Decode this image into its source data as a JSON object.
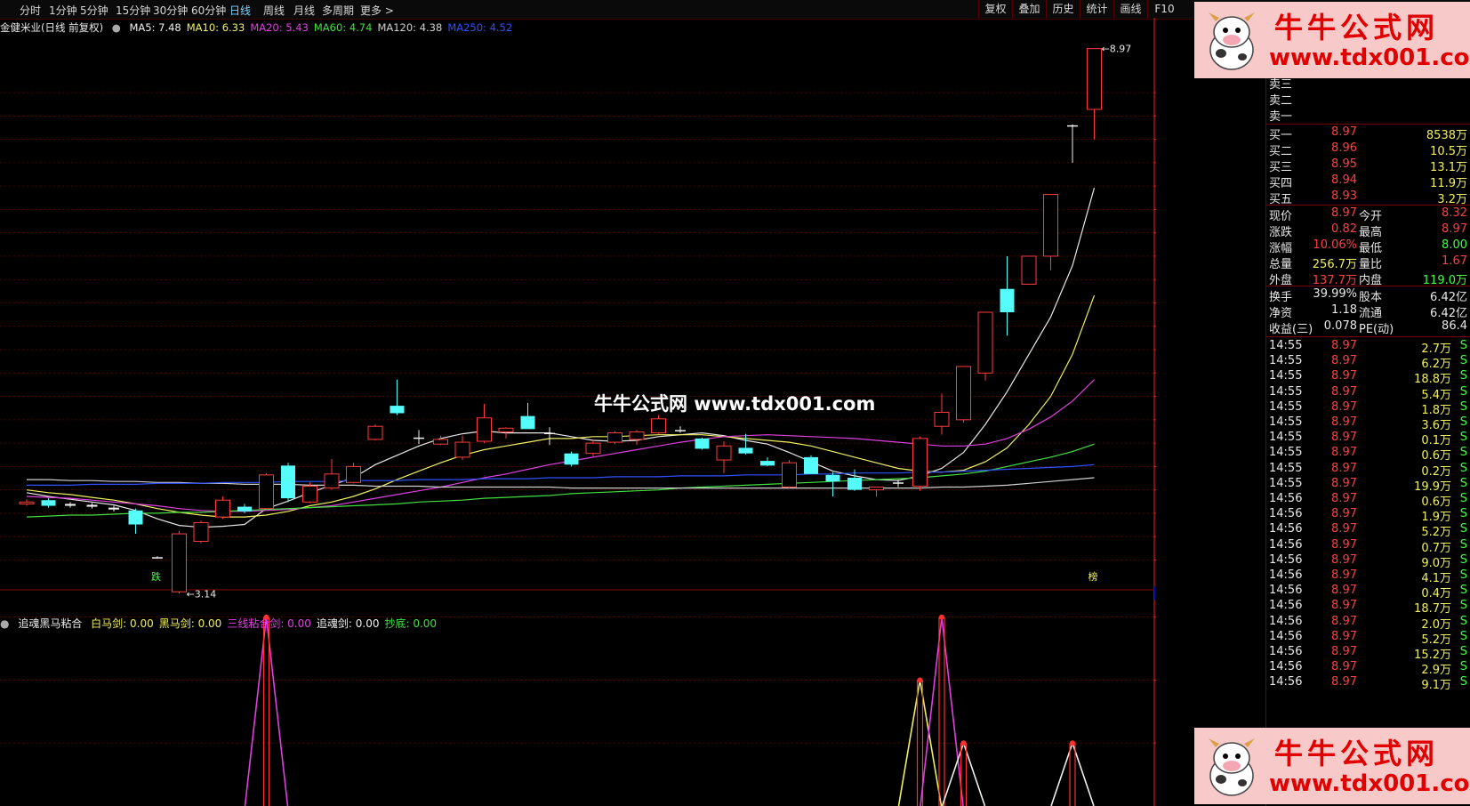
{
  "toolbar": {
    "periods": [
      "分时",
      "1分钟",
      "5分钟",
      "15分钟",
      "30分钟",
      "60分钟",
      "日线",
      "周线",
      "月线",
      "多周期",
      "更多 >"
    ],
    "active_period": "日线",
    "tools": [
      "复权",
      "叠加",
      "历史",
      "统计",
      "画线",
      "F10"
    ]
  },
  "stock_title": "金健米业(日线 前复权)",
  "ma_legend": [
    {
      "label": "MA5: 7.48",
      "color": "#f0f0f0"
    },
    {
      "label": "MA10: 6.33",
      "color": "#f0f060"
    },
    {
      "label": "MA20: 5.43",
      "color": "#e040e0"
    },
    {
      "label": "MA60: 4.74",
      "color": "#40e040"
    },
    {
      "label": "MA120: 4.38",
      "color": "#d0d0d0"
    },
    {
      "label": "MA250: 4.52",
      "color": "#3050ff"
    }
  ],
  "indicator_legend": {
    "name": "追魂黑马粘合",
    "items": [
      {
        "label": "白马剑: 0.00",
        "color": "#f0f060"
      },
      {
        "label": "黑马剑: 0.00",
        "color": "#f0f060"
      },
      {
        "label": "三线粘合剑: 0.00",
        "color": "#e040e0"
      },
      {
        "label": "追魂剑: 0.00",
        "color": "#f0f0f0"
      },
      {
        "label": "抄底: 0.00",
        "color": "#40e040"
      }
    ]
  },
  "markers": {
    "low_label": "3.14",
    "high_label": "8.97",
    "die_label": "跌",
    "axis_low": "3.14",
    "right_tag": "榜"
  },
  "chart_data": [
    {
      "type": "candlestick",
      "title": "金健米业(日线 前复权)",
      "ylim": [
        3.2,
        9.1
      ],
      "yticks": [
        "8.50",
        "8.25",
        "8.00",
        "7.75",
        "7.50",
        "7.25",
        "7.00",
        "6.75",
        "6.50",
        "6.25",
        "6.00",
        "5.75",
        "5.50",
        "5.25",
        "5.00",
        "4.75",
        "4.50",
        "4.25",
        "4.00",
        "3.75",
        "3.50"
      ],
      "candles": [
        {
          "o": 4.1,
          "h": 4.15,
          "l": 4.08,
          "c": 4.12
        },
        {
          "o": 4.14,
          "h": 4.16,
          "l": 4.06,
          "c": 4.08
        },
        {
          "o": 4.08,
          "h": 4.12,
          "l": 4.06,
          "c": 4.1
        },
        {
          "o": 4.09,
          "h": 4.11,
          "l": 4.05,
          "c": 4.07
        },
        {
          "o": 4.06,
          "h": 4.08,
          "l": 4.02,
          "c": 4.04
        },
        {
          "o": 4.03,
          "h": 4.05,
          "l": 3.78,
          "c": 3.88
        },
        {
          "o": 3.53,
          "h": 3.54,
          "l": 3.52,
          "c": 3.53
        },
        {
          "o": 3.16,
          "h": 3.81,
          "l": 3.14,
          "c": 3.78
        },
        {
          "o": 3.7,
          "h": 3.92,
          "l": 3.68,
          "c": 3.9
        },
        {
          "o": 3.96,
          "h": 4.18,
          "l": 3.94,
          "c": 4.14
        },
        {
          "o": 4.07,
          "h": 4.1,
          "l": 4.0,
          "c": 4.02
        },
        {
          "o": 4.05,
          "h": 4.43,
          "l": 4.04,
          "c": 4.41
        },
        {
          "o": 4.51,
          "h": 4.54,
          "l": 4.12,
          "c": 4.16
        },
        {
          "o": 4.12,
          "h": 4.33,
          "l": 4.11,
          "c": 4.29
        },
        {
          "o": 4.27,
          "h": 4.58,
          "l": 4.25,
          "c": 4.42
        },
        {
          "o": 4.33,
          "h": 4.54,
          "l": 4.32,
          "c": 4.5
        },
        {
          "o": 4.79,
          "h": 4.95,
          "l": 4.78,
          "c": 4.93
        },
        {
          "o": 5.15,
          "h": 5.43,
          "l": 5.05,
          "c": 5.07
        },
        {
          "o": 4.81,
          "h": 4.89,
          "l": 4.74,
          "c": 4.8
        },
        {
          "o": 4.74,
          "h": 4.83,
          "l": 4.73,
          "c": 4.79
        },
        {
          "o": 4.6,
          "h": 4.83,
          "l": 4.57,
          "c": 4.76
        },
        {
          "o": 4.77,
          "h": 5.17,
          "l": 4.75,
          "c": 5.02
        },
        {
          "o": 4.87,
          "h": 4.92,
          "l": 4.8,
          "c": 4.91
        },
        {
          "o": 5.04,
          "h": 5.18,
          "l": 4.92,
          "c": 4.9
        },
        {
          "o": 4.85,
          "h": 4.92,
          "l": 4.73,
          "c": 4.86
        },
        {
          "o": 4.64,
          "h": 4.66,
          "l": 4.5,
          "c": 4.52
        },
        {
          "o": 4.64,
          "h": 4.78,
          "l": 4.61,
          "c": 4.75
        },
        {
          "o": 4.76,
          "h": 4.88,
          "l": 4.74,
          "c": 4.86
        },
        {
          "o": 4.79,
          "h": 4.89,
          "l": 4.73,
          "c": 4.87
        },
        {
          "o": 4.86,
          "h": 5.05,
          "l": 4.85,
          "c": 5.01
        },
        {
          "o": 4.89,
          "h": 4.93,
          "l": 4.86,
          "c": 4.89
        },
        {
          "o": 4.8,
          "h": 4.81,
          "l": 4.68,
          "c": 4.69
        },
        {
          "o": 4.57,
          "h": 4.77,
          "l": 4.43,
          "c": 4.72
        },
        {
          "o": 4.7,
          "h": 4.85,
          "l": 4.63,
          "c": 4.64
        },
        {
          "o": 4.56,
          "h": 4.6,
          "l": 4.5,
          "c": 4.51
        },
        {
          "o": 4.28,
          "h": 4.57,
          "l": 4.26,
          "c": 4.54
        },
        {
          "o": 4.6,
          "h": 4.62,
          "l": 4.42,
          "c": 4.42
        },
        {
          "o": 4.41,
          "h": 4.44,
          "l": 4.18,
          "c": 4.34
        },
        {
          "o": 4.38,
          "h": 4.47,
          "l": 4.24,
          "c": 4.25
        },
        {
          "o": 4.25,
          "h": 4.27,
          "l": 4.18,
          "c": 4.28
        },
        {
          "o": 4.32,
          "h": 4.36,
          "l": 4.28,
          "c": 4.33
        },
        {
          "o": 4.29,
          "h": 4.82,
          "l": 4.24,
          "c": 4.8
        },
        {
          "o": 4.93,
          "h": 5.28,
          "l": 4.84,
          "c": 5.08
        },
        {
          "o": 5.0,
          "h": 5.56,
          "l": 4.97,
          "c": 5.57
        },
        {
          "o": 5.5,
          "h": 6.15,
          "l": 5.42,
          "c": 6.15
        },
        {
          "o": 6.4,
          "h": 6.75,
          "l": 5.9,
          "c": 6.15
        },
        {
          "o": 6.45,
          "h": 6.75,
          "l": 6.45,
          "c": 6.75
        },
        {
          "o": 6.75,
          "h": 7.41,
          "l": 6.6,
          "c": 7.41
        },
        {
          "o": 8.15,
          "h": 8.16,
          "l": 7.75,
          "c": 8.15
        },
        {
          "o": 8.32,
          "h": 8.97,
          "l": 8.0,
          "c": 8.97
        }
      ],
      "ma_series": [
        {
          "name": "MA5",
          "color": "#e8e8e8",
          "values": [
            4.22,
            4.18,
            4.15,
            4.12,
            4.09,
            4.03,
            3.94,
            3.87,
            3.85,
            3.86,
            3.88,
            4.05,
            4.13,
            4.22,
            4.3,
            4.38,
            4.52,
            4.62,
            4.72,
            4.8,
            4.85,
            4.88,
            4.86,
            4.86,
            4.86,
            4.82,
            4.78,
            4.77,
            4.78,
            4.82,
            4.84,
            4.86,
            4.83,
            4.78,
            4.74,
            4.65,
            4.55,
            4.45,
            4.4,
            4.36,
            4.35,
            4.4,
            4.48,
            4.65,
            4.95,
            5.3,
            5.7,
            6.1,
            6.65,
            7.48
          ]
        },
        {
          "name": "MA10",
          "color": "#f0f060",
          "values": [
            4.25,
            4.22,
            4.2,
            4.17,
            4.14,
            4.1,
            4.05,
            4.01,
            3.98,
            3.96,
            3.96,
            3.98,
            4.02,
            4.08,
            4.12,
            4.18,
            4.26,
            4.36,
            4.45,
            4.54,
            4.62,
            4.68,
            4.72,
            4.76,
            4.8,
            4.8,
            4.82,
            4.82,
            4.83,
            4.84,
            4.84,
            4.84,
            4.82,
            4.8,
            4.78,
            4.76,
            4.72,
            4.66,
            4.6,
            4.54,
            4.48,
            4.45,
            4.44,
            4.46,
            4.55,
            4.7,
            4.95,
            5.25,
            5.7,
            6.33
          ]
        },
        {
          "name": "MA20",
          "color": "#e040e0",
          "values": [
            4.18,
            4.17,
            4.16,
            4.14,
            4.12,
            4.1,
            4.08,
            4.05,
            4.03,
            4.02,
            4.02,
            4.03,
            4.04,
            4.06,
            4.08,
            4.12,
            4.16,
            4.2,
            4.24,
            4.28,
            4.33,
            4.38,
            4.42,
            4.47,
            4.52,
            4.56,
            4.6,
            4.64,
            4.68,
            4.72,
            4.76,
            4.79,
            4.82,
            4.83,
            4.84,
            4.83,
            4.82,
            4.81,
            4.8,
            4.78,
            4.76,
            4.74,
            4.72,
            4.72,
            4.74,
            4.8,
            4.9,
            5.03,
            5.2,
            5.43
          ]
        },
        {
          "name": "MA60",
          "color": "#40e040",
          "values": [
            3.96,
            3.97,
            3.98,
            3.98,
            3.99,
            4.0,
            4.0,
            4.01,
            4.01,
            4.02,
            4.03,
            4.04,
            4.05,
            4.06,
            4.07,
            4.08,
            4.09,
            4.1,
            4.12,
            4.13,
            4.14,
            4.16,
            4.17,
            4.18,
            4.19,
            4.21,
            4.22,
            4.23,
            4.24,
            4.25,
            4.27,
            4.28,
            4.29,
            4.3,
            4.31,
            4.32,
            4.33,
            4.34,
            4.35,
            4.36,
            4.37,
            4.38,
            4.4,
            4.42,
            4.45,
            4.5,
            4.55,
            4.6,
            4.66,
            4.74
          ]
        },
        {
          "name": "MA120",
          "color": "#d0d0d0",
          "values": [
            4.36,
            4.36,
            4.35,
            4.35,
            4.34,
            4.34,
            4.33,
            4.33,
            4.32,
            4.32,
            4.31,
            4.31,
            4.31,
            4.3,
            4.3,
            4.3,
            4.29,
            4.29,
            4.29,
            4.28,
            4.28,
            4.28,
            4.28,
            4.28,
            4.28,
            4.27,
            4.27,
            4.27,
            4.27,
            4.27,
            4.27,
            4.27,
            4.27,
            4.27,
            4.27,
            4.27,
            4.27,
            4.27,
            4.27,
            4.27,
            4.27,
            4.27,
            4.28,
            4.28,
            4.29,
            4.3,
            4.32,
            4.34,
            4.36,
            4.38
          ]
        },
        {
          "name": "MA250",
          "color": "#3050ff",
          "values": [
            4.3,
            4.3,
            4.3,
            4.31,
            4.31,
            4.31,
            4.32,
            4.32,
            4.32,
            4.33,
            4.33,
            4.33,
            4.34,
            4.34,
            4.34,
            4.35,
            4.35,
            4.35,
            4.36,
            4.36,
            4.36,
            4.37,
            4.37,
            4.37,
            4.38,
            4.38,
            4.38,
            4.39,
            4.39,
            4.39,
            4.4,
            4.4,
            4.4,
            4.41,
            4.41,
            4.41,
            4.42,
            4.42,
            4.43,
            4.43,
            4.43,
            4.44,
            4.44,
            4.45,
            4.46,
            4.47,
            4.48,
            4.49,
            4.5,
            4.52
          ]
        }
      ]
    },
    {
      "type": "line",
      "title": "追魂黑马粘合",
      "ylim": [
        0.4,
        1.05
      ],
      "yticks": [
        "1.00",
        "0.80",
        "0.60"
      ],
      "signals": [
        {
          "index": 11,
          "value": 1.0,
          "color": "#e040e0"
        },
        {
          "index": 41,
          "value": 0.8,
          "color": "#f0f060"
        },
        {
          "index": 42,
          "value": 1.0,
          "color": "#e040e0"
        },
        {
          "index": 43,
          "value": 0.6,
          "color": "#f0f0f0"
        },
        {
          "index": 48,
          "value": 0.6,
          "color": "#f0f0f0"
        }
      ]
    }
  ],
  "quote": {
    "sell_rows": [
      "卖三",
      "卖二",
      "卖一"
    ],
    "buy_rows": [
      {
        "label": "买一",
        "price": "8.97",
        "vol": "8538万"
      },
      {
        "label": "买二",
        "price": "8.96",
        "vol": "10.5万"
      },
      {
        "label": "买三",
        "price": "8.95",
        "vol": "13.1万"
      },
      {
        "label": "买四",
        "price": "8.94",
        "vol": "11.9万"
      },
      {
        "label": "买五",
        "price": "8.93",
        "vol": "3.2万"
      }
    ],
    "stats": [
      {
        "l1": "现价",
        "v1": "8.97",
        "c1": "#ff4040",
        "l2": "今开",
        "v2": "8.32",
        "c2": "#ff4040"
      },
      {
        "l1": "涨跌",
        "v1": "0.82",
        "c1": "#ff4040",
        "l2": "最高",
        "v2": "8.97",
        "c2": "#ff4040"
      },
      {
        "l1": "涨幅",
        "v1": "10.06%",
        "c1": "#ff4040",
        "l2": "最低",
        "v2": "8.00",
        "c2": "#40ff40"
      },
      {
        "l1": "总量",
        "v1": "256.7万",
        "c1": "#f0f060",
        "l2": "量比",
        "v2": "1.67",
        "c2": "#ff4040"
      },
      {
        "l1": "外盘",
        "v1": "137.7万",
        "c1": "#ff4040",
        "l2": "内盘",
        "v2": "119.0万",
        "c2": "#40ff40"
      }
    ],
    "stats2": [
      {
        "l1": "换手",
        "v1": "39.99%",
        "l2": "股本",
        "v2": "6.42亿"
      },
      {
        "l1": "净资",
        "v1": "1.18",
        "l2": "流通",
        "v2": "6.42亿"
      },
      {
        "l1": "收益(三)",
        "v1": "0.078",
        "l2": "PE(动)",
        "v2": "86.4"
      }
    ],
    "ticks": [
      {
        "time": "14:55",
        "price": "8.97",
        "vol": "2.7万",
        "side": "S"
      },
      {
        "time": "14:55",
        "price": "8.97",
        "vol": "6.2万",
        "side": "S"
      },
      {
        "time": "14:55",
        "price": "8.97",
        "vol": "18.8万",
        "side": "S"
      },
      {
        "time": "14:55",
        "price": "8.97",
        "vol": "5.4万",
        "side": "S"
      },
      {
        "time": "14:55",
        "price": "8.97",
        "vol": "1.8万",
        "side": "S"
      },
      {
        "time": "14:55",
        "price": "8.97",
        "vol": "3.6万",
        "side": "S"
      },
      {
        "time": "14:55",
        "price": "8.97",
        "vol": "0.1万",
        "side": "S"
      },
      {
        "time": "14:55",
        "price": "8.97",
        "vol": "0.6万",
        "side": "S"
      },
      {
        "time": "14:55",
        "price": "8.97",
        "vol": "0.2万",
        "side": "S"
      },
      {
        "time": "14:55",
        "price": "8.97",
        "vol": "19.9万",
        "side": "S"
      },
      {
        "time": "14:56",
        "price": "8.97",
        "vol": "0.6万",
        "side": "S"
      },
      {
        "time": "14:56",
        "price": "8.97",
        "vol": "1.9万",
        "side": "S"
      },
      {
        "time": "14:56",
        "price": "8.97",
        "vol": "5.2万",
        "side": "S"
      },
      {
        "time": "14:56",
        "price": "8.97",
        "vol": "0.7万",
        "side": "S"
      },
      {
        "time": "14:56",
        "price": "8.97",
        "vol": "9.0万",
        "side": "S"
      },
      {
        "time": "14:56",
        "price": "8.97",
        "vol": "4.1万",
        "side": "S"
      },
      {
        "time": "14:56",
        "price": "8.97",
        "vol": "0.4万",
        "side": "S"
      },
      {
        "time": "14:56",
        "price": "8.97",
        "vol": "18.7万",
        "side": "S"
      },
      {
        "time": "14:56",
        "price": "8.97",
        "vol": "2.0万",
        "side": "S"
      },
      {
        "time": "14:56",
        "price": "8.97",
        "vol": "5.2万",
        "side": "S"
      },
      {
        "time": "14:56",
        "price": "8.97",
        "vol": "15.2万",
        "side": "S"
      },
      {
        "time": "14:56",
        "price": "8.97",
        "vol": "2.9万",
        "side": "S"
      },
      {
        "time": "14:56",
        "price": "8.97",
        "vol": "9.1万",
        "side": "S"
      }
    ]
  },
  "watermark": {
    "title": "牛牛公式网",
    "url": "www.tdx001.com",
    "center": "牛牛公式网 www.tdx001.com"
  },
  "colors": {
    "up": "#ff3c3c",
    "down": "#54fcfc",
    "grid": "#6a0000",
    "axis": "#ff2020"
  }
}
